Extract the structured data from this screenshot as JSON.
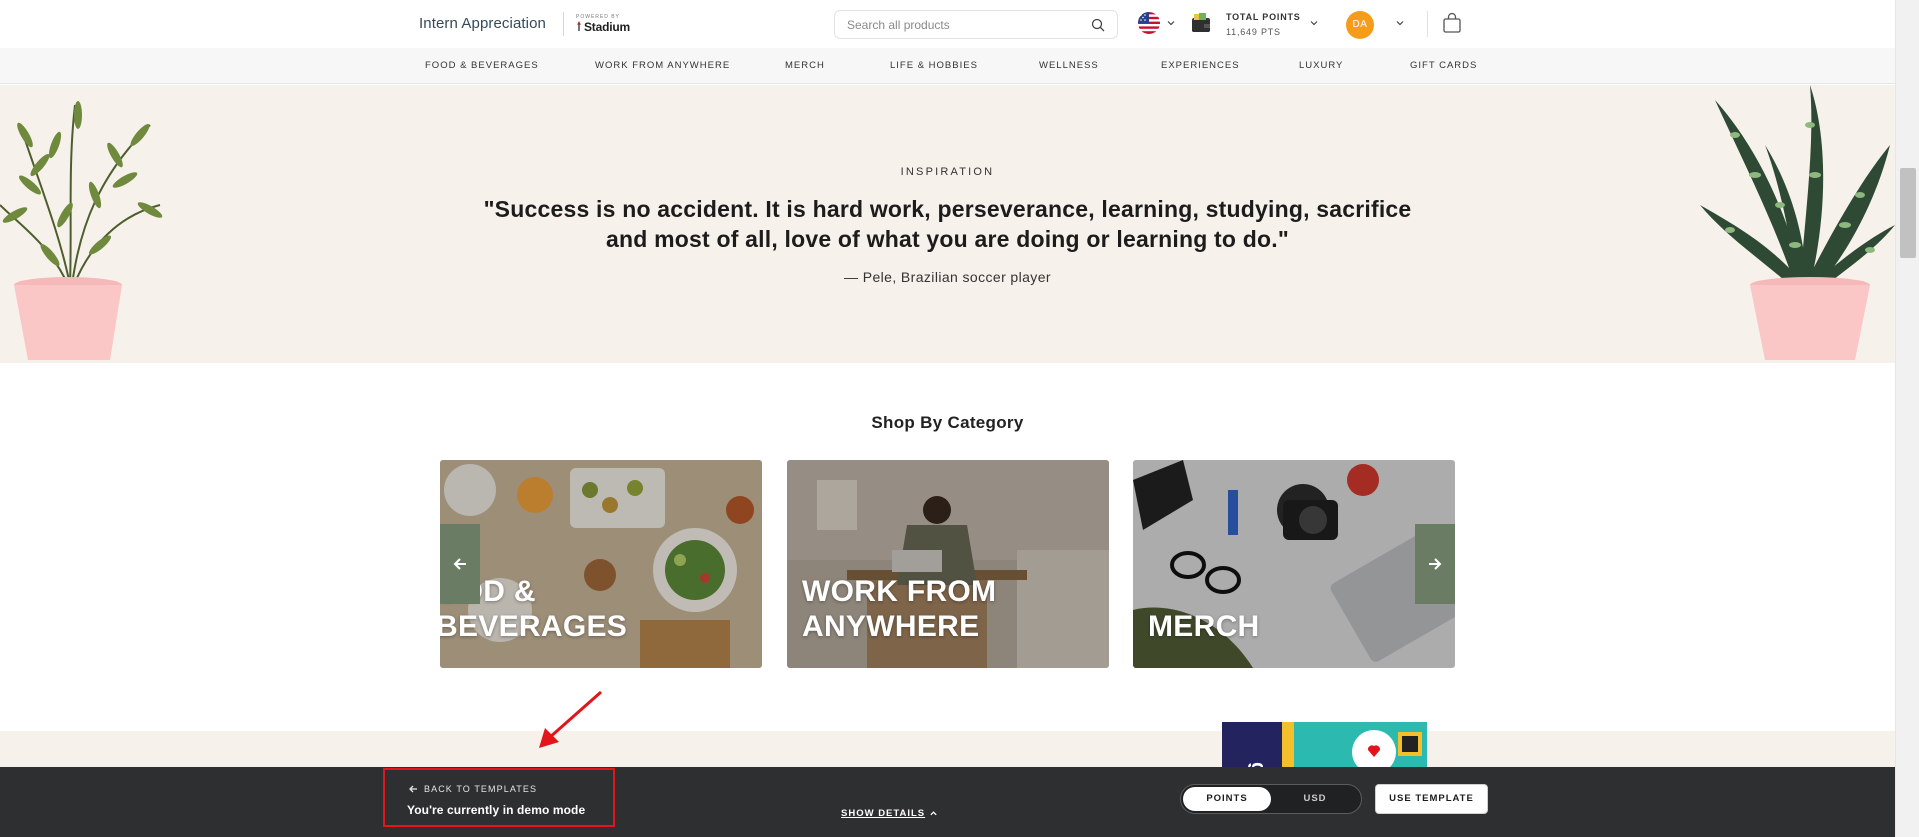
{
  "header": {
    "brand": "Intern Appreciation",
    "powered_by": "POWERED BY",
    "partner": "Stadium",
    "search_placeholder": "Search all products",
    "points_label": "TOTAL POINTS",
    "points_value": "11,649 PTS",
    "avatar_initials": "DA"
  },
  "categories": [
    "FOOD & BEVERAGES",
    "WORK FROM ANYWHERE",
    "MERCH",
    "LIFE & HOBBIES",
    "WELLNESS",
    "EXPERIENCES",
    "LUXURY",
    "GIFT CARDS"
  ],
  "inspiration": {
    "label": "INSPIRATION",
    "quote": "\"Success is no accident. It is hard work, perseverance, learning, studying, sacrifice and most of all, love of what you are doing or learning to do.\"",
    "attribution": "— Pele, Brazilian soccer player"
  },
  "shop": {
    "title": "Shop By Category",
    "cards": [
      "OOD &\nBEVERAGES",
      "WORK FROM\nANYWHERE",
      "MERCH"
    ]
  },
  "demo_bar": {
    "back_label": "BACK TO TEMPLATES",
    "mode_text": "You're currently in demo mode",
    "show_details": "SHOW DETAILS",
    "toggle_points": "POINTS",
    "toggle_usd": "USD",
    "use_template": "USE TEMPLATE"
  },
  "colors": {
    "accent_orange": "#f59d1a",
    "cream": "#f7f1ec",
    "dark_bar": "#2d2f31",
    "highlight_red": "#e3141a",
    "arrow_green": "#6b7c64"
  }
}
